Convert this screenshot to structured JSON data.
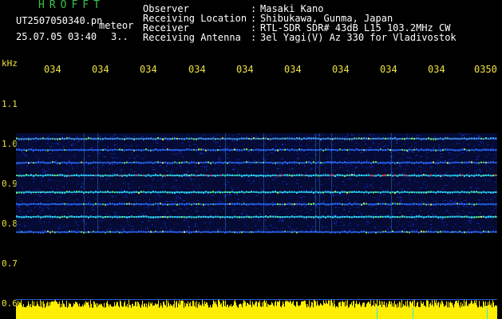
{
  "header": {
    "app_title": "HROFFT",
    "filename": "UT2507050340.pn",
    "meteor_label": "meteor",
    "datetime": "25.07.05 03:40",
    "count": "3..",
    "info": [
      {
        "label": "Observer",
        "value": "Masaki Kano"
      },
      {
        "label": "Receiving Location",
        "value": "Shibukawa, Gunma, Japan"
      },
      {
        "label": "Receiver",
        "value": "RTL-SDR SDR# 43dB L15 103.2MHz CW"
      },
      {
        "label": "Receiving Antenna",
        "value": "3el Yagi(V) Az 330 for Vladivostok"
      }
    ]
  },
  "axis": {
    "unit": "kHz",
    "y_ticks": [
      "1.1",
      "1.0",
      "0.9",
      "0.8",
      "0.7",
      "0.6"
    ],
    "x_ticks": [
      "034",
      "034",
      "034",
      "034",
      "034",
      "034",
      "034",
      "034",
      "034",
      "0350"
    ]
  },
  "colors": {
    "background": "#000000",
    "text_white": "#ffffff",
    "text_green": "#39c24a",
    "text_yellow": "#f0e040",
    "signal_blue": "#1a3cff",
    "signal_red": "#ff3030",
    "level_yellow": "#ffee00"
  }
}
